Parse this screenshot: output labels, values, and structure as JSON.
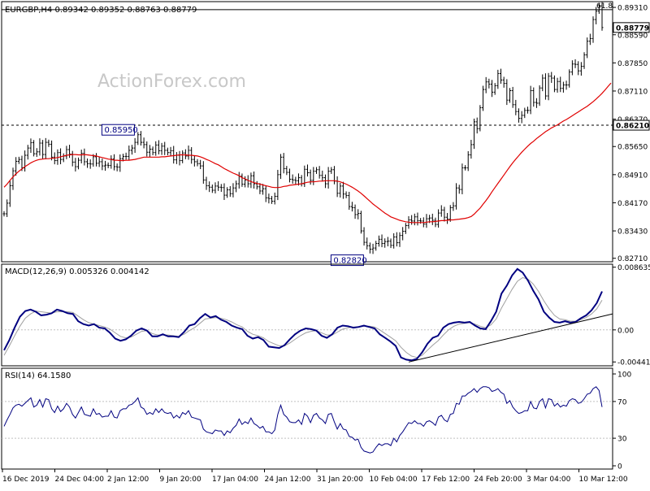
{
  "header": {
    "info": "EURGBP,H4  0.89342 0.89352 0.88763 0.88779"
  },
  "watermark": "ActionForex.com",
  "colors": {
    "bg": "#ffffff",
    "frame": "#000000",
    "candle": "#000000",
    "ma": "#e00000",
    "macd": "#000080",
    "signal": "#a0a0a0",
    "grid": "#c0c0c0",
    "label_box": "#000080"
  },
  "chart_data": [
    {
      "type": "line",
      "name": "price",
      "ylim": [
        0.8264,
        0.8944
      ],
      "y_ticks": [
        "0.89310",
        "0.88590",
        "0.87850",
        "0.87110",
        "0.86370",
        "0.85650",
        "0.84910",
        "0.84170",
        "0.83430",
        "0.82710"
      ],
      "last_price_label": "0.88779",
      "level_label": "0.86210",
      "level_value": 0.8621,
      "resistance_value": 0.8925,
      "resistance_label": "61.8",
      "annotations": [
        {
          "text": "0.85950",
          "value": 0.8595,
          "at": "9 Jan"
        },
        {
          "text": "0.82820",
          "value": 0.8282,
          "at": "12 Feb"
        }
      ],
      "series": [
        {
          "values": [
            0.8388,
            0.8416,
            0.8462,
            0.8501,
            0.8526,
            0.8531,
            0.8509,
            0.8542,
            0.8561,
            0.8575,
            0.8546,
            0.8551,
            0.8574,
            0.8544,
            0.8576,
            0.8571,
            0.8537,
            0.8528,
            0.8549,
            0.8531,
            0.854,
            0.8557,
            0.8545,
            0.8524,
            0.8512,
            0.8529,
            0.8547,
            0.8525,
            0.852,
            0.8519,
            0.8538,
            0.8521,
            0.8525,
            0.8514,
            0.8516,
            0.8515,
            0.8532,
            0.8512,
            0.8511,
            0.8533,
            0.8539,
            0.8539,
            0.8555,
            0.8561,
            0.8576,
            0.8596,
            0.8576,
            0.857,
            0.855,
            0.8558,
            0.8549,
            0.8569,
            0.8554,
            0.8566,
            0.8555,
            0.8549,
            0.8554,
            0.853,
            0.8542,
            0.8528,
            0.8548,
            0.854,
            0.8555,
            0.8531,
            0.8525,
            0.852,
            0.8514,
            0.8477,
            0.8462,
            0.8458,
            0.845,
            0.8461,
            0.8458,
            0.8457,
            0.8437,
            0.8451,
            0.8441,
            0.8456,
            0.8467,
            0.8487,
            0.8466,
            0.8477,
            0.8467,
            0.8488,
            0.8467,
            0.8459,
            0.8448,
            0.8454,
            0.843,
            0.8428,
            0.8421,
            0.8434,
            0.8491,
            0.8537,
            0.8507,
            0.8497,
            0.8479,
            0.8477,
            0.8475,
            0.8483,
            0.8467,
            0.8505,
            0.8496,
            0.8476,
            0.85,
            0.8504,
            0.8489,
            0.8483,
            0.8467,
            0.85,
            0.8504,
            0.8474,
            0.8442,
            0.8461,
            0.844,
            0.8436,
            0.8407,
            0.8404,
            0.8386,
            0.8389,
            0.8343,
            0.8313,
            0.8304,
            0.8295,
            0.8298,
            0.831,
            0.8321,
            0.831,
            0.8315,
            0.8316,
            0.8305,
            0.8327,
            0.8312,
            0.8331,
            0.8342,
            0.8357,
            0.8372,
            0.8369,
            0.838,
            0.837,
            0.8369,
            0.8361,
            0.8375,
            0.8377,
            0.8371,
            0.836,
            0.839,
            0.8398,
            0.8379,
            0.8374,
            0.8404,
            0.8409,
            0.8456,
            0.8452,
            0.8509,
            0.8509,
            0.8543,
            0.857,
            0.863,
            0.8612,
            0.8667,
            0.8715,
            0.8735,
            0.8729,
            0.8708,
            0.8725,
            0.8757,
            0.874,
            0.8731,
            0.8687,
            0.8712,
            0.8675,
            0.8657,
            0.8639,
            0.8647,
            0.866,
            0.866,
            0.8712,
            0.8681,
            0.8679,
            0.8719,
            0.8745,
            0.8698,
            0.875,
            0.8745,
            0.8715,
            0.8736,
            0.8718,
            0.8727,
            0.8727,
            0.8761,
            0.8782,
            0.8781,
            0.8764,
            0.8776,
            0.8806,
            0.8842,
            0.8849,
            0.8899,
            0.8921,
            0.8935,
            0.8878
          ]
        },
        {
          "name": "",
          "values": [
            0.8458,
            0.8466,
            0.8476,
            0.8485,
            0.8493,
            0.85,
            0.8506,
            0.8512,
            0.8517,
            0.8522,
            0.8526,
            0.8529,
            0.8531,
            0.8532,
            0.8533,
            0.8533,
            0.8534,
            0.8535,
            0.8536,
            0.8538,
            0.854,
            0.8542,
            0.8543,
            0.8544,
            0.8544,
            0.8543,
            0.8543,
            0.8544,
            0.8543,
            0.8542,
            0.8541,
            0.854,
            0.8538,
            0.8536,
            0.8534,
            0.8532,
            0.8531,
            0.8529,
            0.8529,
            0.8528,
            0.8528,
            0.8529,
            0.8529,
            0.853,
            0.8531,
            0.8533,
            0.8535,
            0.8537,
            0.8537,
            0.8537,
            0.8537,
            0.8537,
            0.8537,
            0.8538,
            0.8538,
            0.8539,
            0.854,
            0.8541,
            0.8542,
            0.8543,
            0.8543,
            0.8543,
            0.8542,
            0.8542,
            0.8541,
            0.854,
            0.8538,
            0.8535,
            0.8531,
            0.8528,
            0.8524,
            0.852,
            0.8517,
            0.8512,
            0.8507,
            0.8503,
            0.8499,
            0.8495,
            0.8492,
            0.8488,
            0.8483,
            0.848,
            0.8476,
            0.8473,
            0.847,
            0.8468,
            0.8466,
            0.8464,
            0.8462,
            0.846,
            0.8458,
            0.8457,
            0.8457,
            0.8458,
            0.846,
            0.8461,
            0.8463,
            0.8464,
            0.8465,
            0.8466,
            0.8467,
            0.8469,
            0.8471,
            0.8472,
            0.8472,
            0.8473,
            0.8474,
            0.8474,
            0.8475,
            0.8475,
            0.8475,
            0.8475,
            0.8474,
            0.8472,
            0.8469,
            0.8466,
            0.8462,
            0.8458,
            0.8453,
            0.8448,
            0.8442,
            0.8435,
            0.8428,
            0.8421,
            0.8414,
            0.8408,
            0.8402,
            0.8396,
            0.839,
            0.8385,
            0.838,
            0.8377,
            0.8374,
            0.8371,
            0.8369,
            0.8367,
            0.8366,
            0.8365,
            0.8365,
            0.8365,
            0.8365,
            0.8365,
            0.8366,
            0.8367,
            0.8367,
            0.8368,
            0.8369,
            0.837,
            0.837,
            0.8371,
            0.8372,
            0.8372,
            0.8373,
            0.8374,
            0.8375,
            0.8376,
            0.8378,
            0.8381,
            0.8387,
            0.8395,
            0.8403,
            0.8413,
            0.8423,
            0.8434,
            0.8446,
            0.8457,
            0.8468,
            0.8479,
            0.849,
            0.8501,
            0.8512,
            0.8522,
            0.8532,
            0.8541,
            0.855,
            0.8558,
            0.8566,
            0.8573,
            0.8579,
            0.8586,
            0.8592,
            0.8598,
            0.8604,
            0.8609,
            0.8614,
            0.8618,
            0.8622,
            0.8627,
            0.8632,
            0.8636,
            0.8641,
            0.8646,
            0.8651,
            0.8656,
            0.8661,
            0.8666,
            0.8671,
            0.8677,
            0.8683,
            0.869,
            0.8697,
            0.8705,
            0.8714,
            0.8723,
            0.8732
          ]
        }
      ]
    },
    {
      "type": "line",
      "title": "MACD(12,26,9) 0.005326 0.004142",
      "ylim": [
        -0.0045,
        0.0086
      ],
      "y_ticks": [
        "0.008635",
        "0.00",
        "-0.004415"
      ],
      "series": [
        {
          "values": [
            -0.0028,
            -0.0014,
            0.0003,
            0.0018,
            0.0026,
            0.0028,
            0.0025,
            0.002,
            0.0021,
            0.0023,
            0.0028,
            0.0026,
            0.0023,
            0.0022,
            0.0012,
            0.0008,
            0.0006,
            0.0008,
            0.0003,
            0.0002,
            -0.0004,
            -0.0012,
            -0.0015,
            -0.0013,
            -0.0008,
            -0.0001,
            0.0002,
            -0.0001,
            -0.0009,
            -0.0009,
            -0.0006,
            -0.0009,
            -0.0009,
            -0.001,
            -0.0003,
            0.0006,
            0.0008,
            0.0016,
            0.0022,
            0.0017,
            0.0019,
            0.0014,
            0.0011,
            0.0006,
            0.0003,
            0.0001,
            -0.0008,
            -0.0012,
            -0.001,
            -0.0014,
            -0.0023,
            -0.0024,
            -0.0025,
            -0.0021,
            -0.0013,
            -0.0006,
            -0.0001,
            0.0002,
            0.0001,
            -0.0001,
            -0.0008,
            -0.0011,
            -0.0006,
            0.0003,
            0.0006,
            0.0005,
            0.0003,
            0.0004,
            0.0006,
            0.0004,
            0.0002,
            -0.0006,
            -0.0011,
            -0.0016,
            -0.0022,
            -0.0038,
            -0.0041,
            -0.0042,
            -0.004,
            -0.0031,
            -0.0019,
            -0.0011,
            -0.0008,
            0.0003,
            0.0008,
            0.001,
            0.0011,
            0.001,
            0.0011,
            0.0006,
            0.0002,
            0.0001,
            0.0012,
            0.0025,
            0.005,
            0.0061,
            0.0075,
            0.0084,
            0.0079,
            0.0068,
            0.0054,
            0.0042,
            0.0025,
            0.0017,
            0.0011,
            0.001,
            0.0012,
            0.001,
            0.0011,
            0.0016,
            0.002,
            0.0027,
            0.0037,
            0.0053
          ]
        },
        {
          "values": [
            -0.0035,
            -0.0022,
            -0.0008,
            0.0005,
            0.0016,
            0.0022,
            0.0026,
            0.0025,
            0.0024,
            0.0023,
            0.0025,
            0.0025,
            0.0025,
            0.0024,
            0.0019,
            0.0014,
            0.001,
            0.0008,
            0.0006,
            0.0004,
            0.0001,
            -0.0004,
            -0.0009,
            -0.0011,
            -0.001,
            -0.0006,
            -0.0002,
            -0.0001,
            -0.0005,
            -0.0007,
            -0.0007,
            -0.0007,
            -0.0008,
            -0.0009,
            -0.0006,
            -0.0001,
            0.0003,
            0.0009,
            0.0015,
            0.0016,
            0.0017,
            0.0016,
            0.0014,
            0.0011,
            0.0007,
            0.0004,
            -0.0002,
            -0.0006,
            -0.0008,
            -0.0011,
            -0.0016,
            -0.0019,
            -0.0022,
            -0.0022,
            -0.0018,
            -0.0013,
            -0.0008,
            -0.0004,
            -0.0002,
            -0.0001,
            -0.0004,
            -0.0007,
            -0.0007,
            -0.0003,
            0.0001,
            0.0003,
            0.0004,
            0.0004,
            0.0005,
            0.0005,
            0.0004,
            0.0,
            -0.0005,
            -0.001,
            -0.0015,
            -0.0024,
            -0.0031,
            -0.0036,
            -0.0038,
            -0.0035,
            -0.0028,
            -0.0021,
            -0.0015,
            -0.0007,
            0.0,
            0.0005,
            0.0008,
            0.0009,
            0.001,
            0.0008,
            0.0005,
            0.0003,
            0.0007,
            0.0015,
            0.003,
            0.0043,
            0.0056,
            0.0067,
            0.0072,
            0.007,
            0.0063,
            0.0053,
            0.004,
            0.0029,
            0.002,
            0.0015,
            0.0014,
            0.0012,
            0.0012,
            0.0014,
            0.0017,
            0.0022,
            0.0029,
            0.0041
          ]
        }
      ]
    },
    {
      "type": "line",
      "title": "RSI(14) 64.1580",
      "ylim": [
        0,
        100
      ],
      "y_ticks": [
        "100",
        "70",
        "30",
        "0"
      ],
      "levels": [
        70,
        30
      ],
      "series": [
        {
          "values": [
            43,
            50,
            56,
            63,
            66,
            67,
            65,
            68,
            71,
            74,
            64,
            66,
            72,
            64,
            73,
            72,
            62,
            58,
            65,
            59,
            62,
            68,
            64,
            56,
            52,
            58,
            64,
            56,
            55,
            54,
            62,
            56,
            57,
            53,
            54,
            54,
            60,
            53,
            52,
            60,
            62,
            62,
            66,
            67,
            70,
            74,
            64,
            62,
            56,
            58,
            56,
            62,
            58,
            62,
            58,
            57,
            58,
            52,
            55,
            52,
            58,
            56,
            60,
            53,
            52,
            51,
            50,
            40,
            37,
            36,
            35,
            39,
            38,
            38,
            33,
            38,
            36,
            41,
            44,
            51,
            45,
            48,
            46,
            52,
            46,
            44,
            41,
            43,
            37,
            37,
            35,
            39,
            56,
            66,
            56,
            53,
            48,
            47,
            47,
            50,
            45,
            57,
            54,
            47,
            55,
            57,
            52,
            50,
            46,
            56,
            57,
            48,
            40,
            46,
            40,
            39,
            32,
            31,
            28,
            29,
            20,
            16,
            15,
            14,
            15,
            20,
            24,
            22,
            24,
            24,
            22,
            30,
            26,
            33,
            37,
            42,
            47,
            46,
            49,
            46,
            46,
            43,
            48,
            49,
            47,
            44,
            53,
            55,
            50,
            48,
            56,
            57,
            68,
            67,
            76,
            76,
            79,
            81,
            84,
            80,
            84,
            86,
            86,
            85,
            81,
            82,
            84,
            80,
            78,
            68,
            71,
            64,
            60,
            57,
            58,
            60,
            60,
            70,
            63,
            62,
            70,
            73,
            63,
            73,
            72,
            65,
            68,
            64,
            66,
            65,
            71,
            73,
            72,
            68,
            69,
            73,
            78,
            79,
            84,
            86,
            82,
            64
          ]
        }
      ]
    }
  ],
  "x_axis": {
    "labels": [
      "16 Dec 2019",
      "24 Dec 04:00",
      "2 Jan 12:00",
      "9 Jan 20:00",
      "17 Jan 04:00",
      "24 Jan 12:00",
      "31 Jan 20:00",
      "10 Feb 04:00",
      "17 Feb 12:00",
      "24 Feb 20:00",
      "3 Mar 04:00",
      "10 Mar 12:00"
    ]
  }
}
